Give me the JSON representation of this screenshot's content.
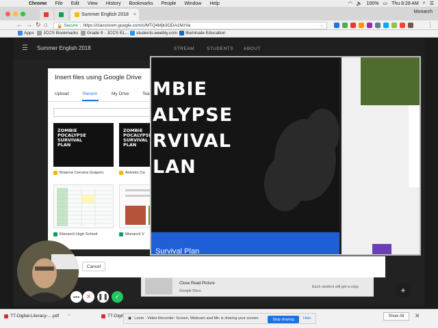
{
  "menubar": {
    "app": "Chrome",
    "items": [
      "File",
      "Edit",
      "View",
      "History",
      "Bookmarks",
      "People",
      "Window",
      "Help"
    ],
    "battery": "100%",
    "clock": "Thu 8:28 AM"
  },
  "tabs": {
    "active_title": "Summer English 2018",
    "profile": "Monarch"
  },
  "address_bar": {
    "secure_label": "Secure",
    "url": "https://classroom.google.com/c/MTQ4Mjk3ODA1MzVa"
  },
  "bookmarks": [
    "Apps",
    "JCCS Bookmarks",
    "Grade 9 - JCCS EL...",
    "students.weebly.com",
    "Illuminate Education"
  ],
  "classroom": {
    "title": "Summer English 2018",
    "nav": [
      "STREAM",
      "STUDENTS",
      "ABOUT"
    ],
    "item_title": "Close Read Picture",
    "item_source": "Google Docs",
    "item_note": "Each student will get a copy"
  },
  "drive_dialog": {
    "title": "Insert files using Google Drive",
    "tabs": [
      "Upload",
      "Recent",
      "My Drive",
      "Tea"
    ],
    "active_tab": "Recent",
    "files": [
      {
        "name": "Brianna Cervera Guijarro",
        "thumb_text": "ZOMBIE\nPOCALYPSE\nSURVIVAL\nPLAN",
        "icon_color": "#f4b400"
      },
      {
        "name": "Antonio Ca",
        "thumb_text": "ZOMBIE\nPOCALYPSE\nSURVIVAL\nPLAN",
        "icon_color": "#f4b400"
      },
      {
        "name": "Monarch High School",
        "thumb_text": "",
        "icon_color": "#0f9d58"
      },
      {
        "name": "Monarch V",
        "thumb_text": "",
        "icon_color": "#0f9d58"
      }
    ],
    "cancel_label": "Cancel"
  },
  "preview": {
    "title_lines": "MBIE\nALYPSE\nRVIVAL\nLAN",
    "subtitle": "Survival Plan"
  },
  "downloads": [
    {
      "name": "TT-Digital-Literacy-....pdf"
    },
    {
      "name": "TT-Digital-Lit"
    }
  ],
  "download_shelf": {
    "show_all": "Show All"
  },
  "loom": {
    "message": "Loom - Video Recorder: Screen, Webcam and Mic is sharing your screen.",
    "stop_label": "Stop sharing",
    "hide_label": "Hide"
  },
  "colors": {
    "accent_blue": "#1a73e8",
    "preview_blue": "#1e5fd6",
    "stop_red": "#e74c3c",
    "confirm_green": "#22c55e"
  }
}
